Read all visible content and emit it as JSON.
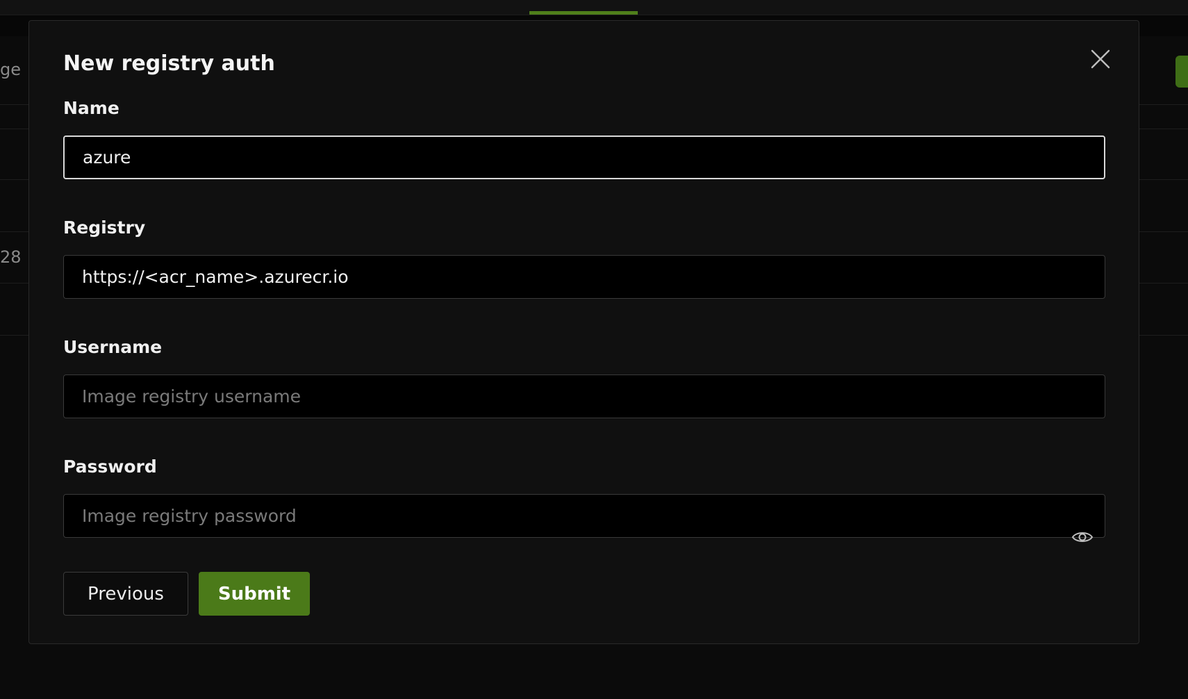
{
  "background": {
    "fragment_top": "ge",
    "fragment_row": "28"
  },
  "modal": {
    "title": "New registry auth",
    "fields": {
      "name": {
        "label": "Name",
        "value": "azure",
        "placeholder": ""
      },
      "registry": {
        "label": "Registry",
        "value": "https://<acr_name>.azurecr.io",
        "placeholder": ""
      },
      "username": {
        "label": "Username",
        "value": "",
        "placeholder": "Image registry username"
      },
      "password": {
        "label": "Password",
        "value": "",
        "placeholder": "Image registry password"
      }
    },
    "buttons": {
      "previous": "Previous",
      "submit": "Submit"
    },
    "icons": {
      "close": "close-icon",
      "password_toggle": "eye-icon"
    }
  },
  "colors": {
    "accent": "#4b7a19",
    "modal_bg": "#101010",
    "input_bg": "#000000"
  }
}
